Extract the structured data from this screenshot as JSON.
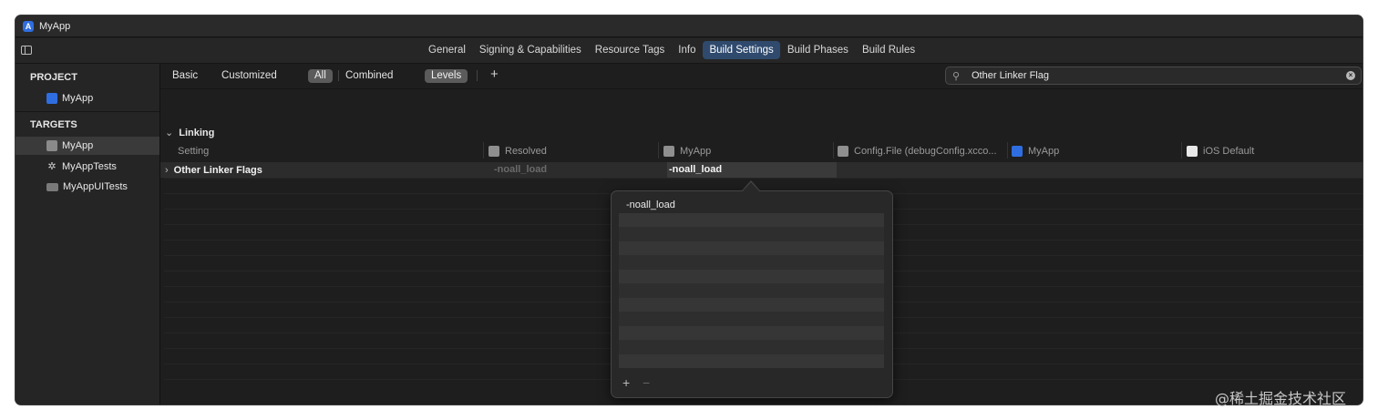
{
  "window": {
    "title": "MyApp"
  },
  "tabs": [
    {
      "label": "General"
    },
    {
      "label": "Signing & Capabilities"
    },
    {
      "label": "Resource Tags"
    },
    {
      "label": "Info"
    },
    {
      "label": "Build Settings",
      "active": true
    },
    {
      "label": "Build Phases"
    },
    {
      "label": "Build Rules"
    }
  ],
  "sidebar": {
    "project_header": "PROJECT",
    "project_item": "MyApp",
    "targets_header": "TARGETS",
    "targets": [
      {
        "label": "MyApp",
        "selected": true
      },
      {
        "label": "MyAppTests"
      },
      {
        "label": "MyAppUITests"
      }
    ]
  },
  "filters": {
    "basic": "Basic",
    "customized": "Customized",
    "all": "All",
    "combined": "Combined",
    "levels": "Levels",
    "add": "+"
  },
  "search": {
    "value": "Other Linker Flag",
    "placeholder": ""
  },
  "section": {
    "title": "Linking"
  },
  "columns": {
    "setting": "Setting",
    "resolved": "Resolved",
    "myapp": "MyApp",
    "config": "Config.File (debugConfig.xcco...",
    "project": "MyApp",
    "ios_default": "iOS Default"
  },
  "setting_row": {
    "name": "Other Linker Flags",
    "resolved": "-noall_load",
    "myapp": "-noall_load"
  },
  "popover": {
    "value": "-noall_load",
    "add": "+",
    "remove": "−"
  },
  "watermark": "@稀土掘金技术社区",
  "colors": {
    "accent": "#2f6ee0",
    "active_tab": "#2f4a6d",
    "background": "#1e1e1e"
  }
}
